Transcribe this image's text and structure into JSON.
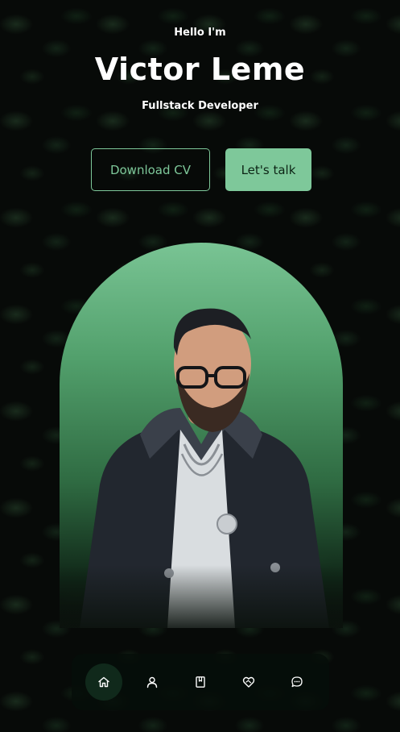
{
  "hero": {
    "greeting": "Hello I'm",
    "name": "Victor Leme",
    "role": "Fullstack Developer"
  },
  "buttons": {
    "download_cv": "Download CV",
    "lets_talk": "Let's talk"
  },
  "nav": {
    "items": [
      {
        "icon": "home-icon",
        "active": true
      },
      {
        "icon": "user-icon",
        "active": false
      },
      {
        "icon": "book-icon",
        "active": false
      },
      {
        "icon": "heart-handshake-icon",
        "active": false
      },
      {
        "icon": "chat-icon",
        "active": false
      }
    ]
  },
  "colors": {
    "accent": "#7ec89a",
    "background": "#070a08",
    "nav_bg": "#060e09",
    "nav_active": "#10291b"
  }
}
